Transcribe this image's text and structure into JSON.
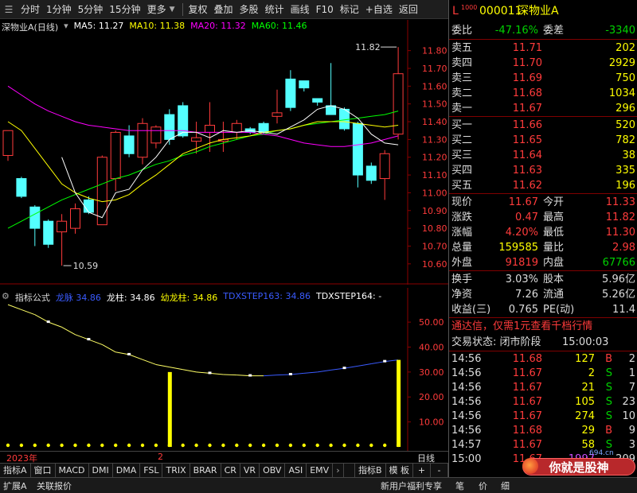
{
  "toolbar": {
    "items": [
      "分时",
      "1分钟",
      "5分钟",
      "15分钟",
      "更多",
      "复权",
      "叠加",
      "多股",
      "统计",
      "画线",
      "F10",
      "标记",
      "+自选",
      "返回"
    ]
  },
  "stock": {
    "code": "000011",
    "name": "深物业A",
    "chart_title": "深物业A(日线)",
    "badge": "L",
    "market": "1000"
  },
  "ma": {
    "ma5": "MA5: 11.27",
    "ma10": "MA10: 11.38",
    "ma20": "MA20: 11.32",
    "ma60": "MA60: 11.46",
    "colors": {
      "ma5": "#ffffff",
      "ma10": "#ffff00",
      "ma20": "#ff00ff",
      "ma60": "#00ff00"
    }
  },
  "chart_data": [
    {
      "type": "candlestick",
      "y_ticks": [
        "11.80",
        "11.70",
        "11.60",
        "11.50",
        "11.40",
        "11.30",
        "11.20",
        "11.10",
        "11.00",
        "10.90",
        "10.80",
        "10.70",
        "10.60"
      ],
      "ylim": [
        10.55,
        11.87
      ],
      "high_label": "11.82",
      "low_label": "10.59",
      "candles": [
        {
          "o": 11.21,
          "h": 11.34,
          "l": 11.18,
          "c": 11.35
        },
        {
          "o": 11.08,
          "h": 11.09,
          "l": 10.97,
          "c": 10.98
        },
        {
          "o": 10.92,
          "h": 10.93,
          "l": 10.7,
          "c": 10.8
        },
        {
          "o": 10.84,
          "h": 10.85,
          "l": 10.69,
          "c": 10.71
        },
        {
          "o": 10.78,
          "h": 10.88,
          "l": 10.59,
          "c": 10.84
        },
        {
          "o": 10.8,
          "h": 10.94,
          "l": 10.77,
          "c": 10.91
        },
        {
          "o": 10.96,
          "h": 10.98,
          "l": 10.88,
          "c": 10.89
        },
        {
          "o": 10.82,
          "h": 11.21,
          "l": 10.82,
          "c": 11.2
        },
        {
          "o": 11.08,
          "h": 11.35,
          "l": 11.01,
          "c": 11.34
        },
        {
          "o": 11.32,
          "h": 11.38,
          "l": 11.2,
          "c": 11.22
        },
        {
          "o": 11.2,
          "h": 11.42,
          "l": 11.16,
          "c": 11.39
        },
        {
          "o": 11.28,
          "h": 11.38,
          "l": 11.25,
          "c": 11.37
        },
        {
          "o": 11.44,
          "h": 11.47,
          "l": 11.27,
          "c": 11.3
        },
        {
          "o": 11.49,
          "h": 11.51,
          "l": 11.31,
          "c": 11.32
        },
        {
          "o": 11.29,
          "h": 11.4,
          "l": 11.22,
          "c": 11.31
        },
        {
          "o": 11.34,
          "h": 11.51,
          "l": 11.23,
          "c": 11.38
        },
        {
          "o": 11.29,
          "h": 11.4,
          "l": 11.23,
          "c": 11.3
        },
        {
          "o": 11.34,
          "h": 11.41,
          "l": 11.3,
          "c": 11.39
        },
        {
          "o": 11.36,
          "h": 11.37,
          "l": 11.33,
          "c": 11.34
        },
        {
          "o": 11.39,
          "h": 11.4,
          "l": 11.33,
          "c": 11.34
        },
        {
          "o": 11.43,
          "h": 11.58,
          "l": 11.39,
          "c": 11.45
        },
        {
          "o": 11.64,
          "h": 11.69,
          "l": 11.46,
          "c": 11.48
        },
        {
          "o": 11.63,
          "h": 11.63,
          "l": 11.57,
          "c": 11.59
        },
        {
          "o": 11.53,
          "h": 11.53,
          "l": 11.49,
          "c": 11.51
        },
        {
          "o": 11.49,
          "h": 11.73,
          "l": 11.44,
          "c": 11.44
        },
        {
          "o": 11.47,
          "h": 11.48,
          "l": 11.35,
          "c": 11.36
        },
        {
          "o": 11.39,
          "h": 11.4,
          "l": 11.03,
          "c": 11.1
        },
        {
          "o": 11.15,
          "h": 11.17,
          "l": 11.05,
          "c": 11.07
        },
        {
          "o": 11.08,
          "h": 11.24,
          "l": 10.96,
          "c": 11.22
        },
        {
          "o": 11.33,
          "h": 11.82,
          "l": 11.3,
          "c": 11.67
        }
      ],
      "ma5": [
        null,
        null,
        null,
        null,
        11.2,
        11.0,
        10.89,
        10.86,
        11.0,
        11.02,
        11.13,
        11.2,
        11.3,
        11.34,
        11.34,
        11.31,
        11.35,
        11.34,
        11.35,
        11.34,
        11.33,
        11.37,
        11.41,
        11.47,
        11.49,
        11.47,
        11.42,
        11.33,
        11.28,
        11.27
      ],
      "ma10": [
        11.4,
        11.35,
        11.25,
        11.15,
        11.05,
        11.0,
        10.97,
        10.95,
        10.96,
        10.99,
        11.05,
        11.1,
        11.16,
        11.22,
        11.25,
        11.28,
        11.3,
        11.31,
        11.32,
        11.34,
        11.35,
        11.36,
        11.38,
        11.4,
        11.4,
        11.4,
        11.39,
        11.38,
        11.37,
        11.38
      ],
      "ma20": [
        11.6,
        11.55,
        11.5,
        11.46,
        11.43,
        11.4,
        11.38,
        11.37,
        11.36,
        11.35,
        11.35,
        11.35,
        11.35,
        11.35,
        11.34,
        11.34,
        11.34,
        11.34,
        11.34,
        11.33,
        11.32,
        11.3,
        11.28,
        11.27,
        11.26,
        11.26,
        11.27,
        11.28,
        11.3,
        11.32
      ],
      "ma60": [
        10.8,
        10.84,
        10.88,
        10.92,
        10.96,
        10.99,
        11.02,
        11.05,
        11.08,
        11.1,
        11.13,
        11.16,
        11.18,
        11.21,
        11.23,
        11.26,
        11.28,
        11.3,
        11.32,
        11.33,
        11.35,
        11.36,
        11.38,
        11.39,
        11.4,
        11.41,
        11.42,
        11.43,
        11.44,
        11.46
      ]
    },
    {
      "type": "line",
      "y_ticks": [
        "50.00",
        "40.00",
        "30.00",
        "20.00",
        "10.00"
      ],
      "ylim": [
        0,
        58
      ],
      "series": [
        {
          "name": "龙脉",
          "values": [
            57,
            55,
            53,
            50,
            48,
            45,
            43,
            41,
            38,
            37,
            35,
            33,
            32,
            31,
            30,
            29.5,
            29,
            28.8,
            28.5,
            28.5,
            28.8,
            29,
            29.5,
            30,
            30.8,
            31.5,
            32.4,
            33.3,
            34.2,
            34.86
          ]
        },
        {
          "name": "龙柱",
          "values": [
            null,
            null,
            null,
            null,
            null,
            null,
            null,
            null,
            null,
            null,
            null,
            null,
            30,
            null,
            null,
            null,
            null,
            null,
            null,
            null,
            null,
            null,
            null,
            null,
            null,
            null,
            null,
            null,
            null,
            34.86
          ]
        }
      ]
    }
  ],
  "indicator": {
    "label": "指标公式",
    "l1_name": "龙脉",
    "l1_val": "34.86",
    "l2": "龙柱: 34.86",
    "l3": "幼龙柱: 34.86",
    "l4": "TDXSTEP163: 34.86",
    "l5": "TDXSTEP164: -"
  },
  "axis": {
    "year": "2023年",
    "mark": "2",
    "right": "日线"
  },
  "tabs": [
    "指标A",
    "窗口",
    "MACD",
    "DMI",
    "DMA",
    "FSL",
    "TRIX",
    "BRAR",
    "CR",
    "VR",
    "OBV",
    "ASI",
    "EMV",
    "指标B",
    "模 板",
    "+",
    "-"
  ],
  "bottom": {
    "left": [
      "扩展A",
      "关联报价"
    ],
    "right": [
      "新用户福利专享",
      "笔",
      "价",
      "细"
    ],
    "watermark": "你就是股神",
    "site": "694.cn"
  },
  "panel": {
    "webi_label": "委比",
    "webi": "-47.16%",
    "weicha_label": "委差",
    "weicha": "-3340",
    "sell": [
      {
        "label": "卖五",
        "price": "11.71",
        "vol": "202"
      },
      {
        "label": "卖四",
        "price": "11.70",
        "vol": "2929"
      },
      {
        "label": "卖三",
        "price": "11.69",
        "vol": "750"
      },
      {
        "label": "卖二",
        "price": "11.68",
        "vol": "1034"
      },
      {
        "label": "卖一",
        "price": "11.67",
        "vol": "296"
      }
    ],
    "buy": [
      {
        "label": "买一",
        "price": "11.66",
        "vol": "520"
      },
      {
        "label": "买二",
        "price": "11.65",
        "vol": "782"
      },
      {
        "label": "买三",
        "price": "11.64",
        "vol": "38"
      },
      {
        "label": "买四",
        "price": "11.63",
        "vol": "335"
      },
      {
        "label": "买五",
        "price": "11.62",
        "vol": "196"
      }
    ],
    "quote": [
      {
        "l1": "现价",
        "v1": "11.67",
        "c1": "red",
        "l2": "今开",
        "v2": "11.33",
        "c2": "red"
      },
      {
        "l1": "涨跌",
        "v1": "0.47",
        "c1": "red",
        "l2": "最高",
        "v2": "11.82",
        "c2": "red"
      },
      {
        "l1": "涨幅",
        "v1": "4.20%",
        "c1": "red",
        "l2": "最低",
        "v2": "11.30",
        "c2": "red"
      },
      {
        "l1": "总量",
        "v1": "159585",
        "c1": "yellow",
        "l2": "量比",
        "v2": "2.98",
        "c2": "red"
      },
      {
        "l1": "外盘",
        "v1": "91819",
        "c1": "red",
        "l2": "内盘",
        "v2": "67766",
        "c2": "green"
      }
    ],
    "fin": [
      {
        "l1": "换手",
        "v1": "3.03%",
        "l2": "股本",
        "v2": "5.96亿"
      },
      {
        "l1": "净资",
        "v1": "7.26",
        "l2": "流通",
        "v2": "5.26亿"
      },
      {
        "l1": "收益(三)",
        "v1": "0.765",
        "l2": "PE(动)",
        "v2": "11.4"
      }
    ],
    "promo": "通达信，仅需1元查看千档行情",
    "status_label": "交易状态: 闭市阶段",
    "status_time": "15:00:03",
    "ticks": [
      {
        "t": "14:56",
        "p": "11.68",
        "pc": "red",
        "v": "127",
        "vc": "yellow",
        "s": "B",
        "sc": "red",
        "n": "2"
      },
      {
        "t": "14:56",
        "p": "11.67",
        "pc": "red",
        "v": "2",
        "vc": "yellow",
        "s": "S",
        "sc": "green",
        "n": "1"
      },
      {
        "t": "14:56",
        "p": "11.67",
        "pc": "red",
        "v": "21",
        "vc": "yellow",
        "s": "S",
        "sc": "green",
        "n": "7"
      },
      {
        "t": "14:56",
        "p": "11.67",
        "pc": "red",
        "v": "105",
        "vc": "yellow",
        "s": "S",
        "sc": "green",
        "n": "23"
      },
      {
        "t": "14:56",
        "p": "11.67",
        "pc": "red",
        "v": "274",
        "vc": "yellow",
        "s": "S",
        "sc": "green",
        "n": "10"
      },
      {
        "t": "14:56",
        "p": "11.68",
        "pc": "red",
        "v": "29",
        "vc": "yellow",
        "s": "B",
        "sc": "red",
        "n": "9"
      },
      {
        "t": "14:57",
        "p": "11.67",
        "pc": "red",
        "v": "58",
        "vc": "yellow",
        "s": "S",
        "sc": "green",
        "n": "3"
      },
      {
        "t": "15:00",
        "p": "11.67",
        "pc": "red",
        "v": "1997",
        "vc": "purple",
        "s": "",
        "sc": "white",
        "n": "209"
      }
    ]
  }
}
